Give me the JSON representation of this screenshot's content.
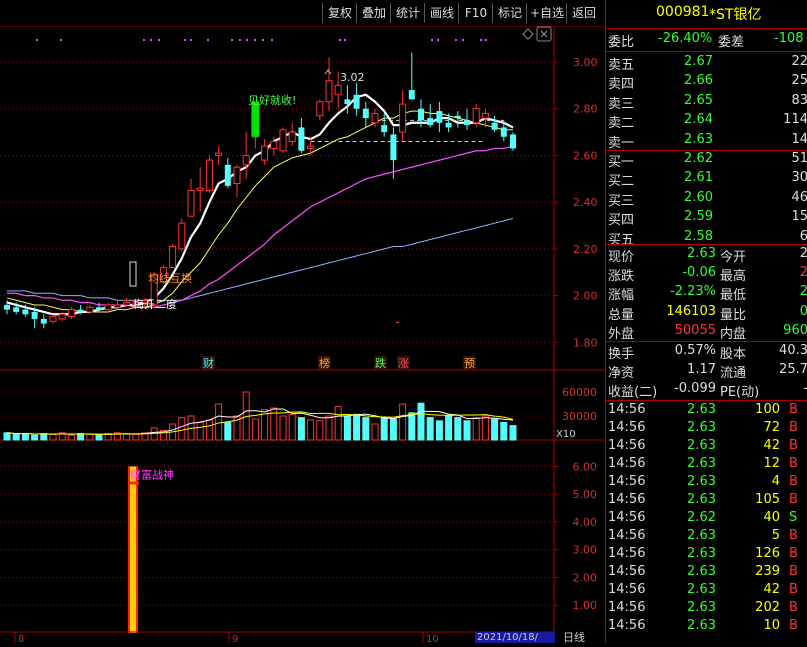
{
  "toolbar": {
    "buttons": [
      "复权",
      "叠加",
      "统计",
      "画线",
      "F10",
      "标记",
      "+自选",
      "返回"
    ]
  },
  "main_chart": {
    "y_ticks": [
      "3.00",
      "2.80",
      "2.60",
      "2.40",
      "2.20",
      "2.00",
      "1.80"
    ],
    "annotations": {
      "peak": "3.02",
      "sell_signal": "见好就收!",
      "cross_label": "均线互换",
      "pattern_label": "梅开二度"
    },
    "event_markers": [
      "财",
      "榜",
      "跌",
      "涨",
      "预"
    ],
    "colors": {
      "up": "#ff3232",
      "down": "#54fcfc",
      "ma5": "#ffffff",
      "ma10": "#ffff50",
      "ma20": "#ff50ff",
      "ma60": "#90b0ff"
    }
  },
  "chart_data": [
    {
      "type": "candlestick",
      "ylim": [
        1.72,
        3.12
      ],
      "y_ticks": [
        3.0,
        2.8,
        2.6,
        2.4,
        2.2,
        2.0,
        1.8
      ],
      "candles": [
        {
          "o": 1.96,
          "h": 1.98,
          "l": 1.92,
          "c": 1.94
        },
        {
          "o": 1.95,
          "h": 1.97,
          "l": 1.92,
          "c": 1.93
        },
        {
          "o": 1.94,
          "h": 1.96,
          "l": 1.91,
          "c": 1.92
        },
        {
          "o": 1.93,
          "h": 1.95,
          "l": 1.86,
          "c": 1.9
        },
        {
          "o": 1.9,
          "h": 1.92,
          "l": 1.86,
          "c": 1.88
        },
        {
          "o": 1.89,
          "h": 1.92,
          "l": 1.88,
          "c": 1.91
        },
        {
          "o": 1.9,
          "h": 1.93,
          "l": 1.89,
          "c": 1.92
        },
        {
          "o": 1.91,
          "h": 1.95,
          "l": 1.9,
          "c": 1.94
        },
        {
          "o": 1.94,
          "h": 1.96,
          "l": 1.92,
          "c": 1.93
        },
        {
          "o": 1.93,
          "h": 1.96,
          "l": 1.92,
          "c": 1.95
        },
        {
          "o": 1.95,
          "h": 1.97,
          "l": 1.93,
          "c": 1.94
        },
        {
          "o": 1.94,
          "h": 1.97,
          "l": 1.93,
          "c": 1.96
        },
        {
          "o": 1.95,
          "h": 1.98,
          "l": 1.94,
          "c": 1.96
        },
        {
          "o": 1.96,
          "h": 1.99,
          "l": 1.95,
          "c": 1.97
        },
        {
          "o": 1.96,
          "h": 1.98,
          "l": 1.95,
          "c": 1.97
        },
        {
          "o": 1.97,
          "h": 1.99,
          "l": 1.95,
          "c": 1.98
        },
        {
          "o": 1.96,
          "h": 2.1,
          "l": 1.95,
          "c": 2.09
        },
        {
          "o": 2.06,
          "h": 2.13,
          "l": 2.05,
          "c": 2.12
        },
        {
          "o": 2.12,
          "h": 2.22,
          "l": 2.12,
          "c": 2.21
        },
        {
          "o": 2.2,
          "h": 2.33,
          "l": 2.19,
          "c": 2.31
        },
        {
          "o": 2.34,
          "h": 2.5,
          "l": 2.34,
          "c": 2.45
        },
        {
          "o": 2.45,
          "h": 2.55,
          "l": 2.36,
          "c": 2.46
        },
        {
          "o": 2.45,
          "h": 2.6,
          "l": 2.44,
          "c": 2.58
        },
        {
          "o": 2.6,
          "h": 2.64,
          "l": 2.56,
          "c": 2.61
        },
        {
          "o": 2.56,
          "h": 2.59,
          "l": 2.46,
          "c": 2.47
        },
        {
          "o": 2.48,
          "h": 2.56,
          "l": 2.42,
          "c": 2.55
        },
        {
          "o": 2.56,
          "h": 2.7,
          "l": 2.5,
          "c": 2.6
        },
        {
          "o": 2.68,
          "h": 2.83,
          "l": 2.63,
          "c": 2.82
        },
        {
          "o": 2.58,
          "h": 2.67,
          "l": 2.56,
          "c": 2.64
        },
        {
          "o": 2.63,
          "h": 2.68,
          "l": 2.6,
          "c": 2.66
        },
        {
          "o": 2.62,
          "h": 2.72,
          "l": 2.61,
          "c": 2.71
        },
        {
          "o": 2.66,
          "h": 2.74,
          "l": 2.64,
          "c": 2.7
        },
        {
          "o": 2.72,
          "h": 2.76,
          "l": 2.61,
          "c": 2.62
        },
        {
          "o": 2.63,
          "h": 2.68,
          "l": 2.6,
          "c": 2.64
        },
        {
          "o": 2.77,
          "h": 2.84,
          "l": 2.75,
          "c": 2.83
        },
        {
          "o": 2.83,
          "h": 3.02,
          "l": 2.79,
          "c": 2.92
        },
        {
          "o": 2.86,
          "h": 2.96,
          "l": 2.8,
          "c": 2.9
        },
        {
          "o": 2.84,
          "h": 2.9,
          "l": 2.78,
          "c": 2.82
        },
        {
          "o": 2.86,
          "h": 2.91,
          "l": 2.77,
          "c": 2.8
        },
        {
          "o": 2.8,
          "h": 2.83,
          "l": 2.72,
          "c": 2.76
        },
        {
          "o": 2.74,
          "h": 2.8,
          "l": 2.72,
          "c": 2.78
        },
        {
          "o": 2.73,
          "h": 2.78,
          "l": 2.68,
          "c": 2.7
        },
        {
          "o": 2.69,
          "h": 2.72,
          "l": 2.5,
          "c": 2.58
        },
        {
          "o": 2.7,
          "h": 2.88,
          "l": 2.66,
          "c": 2.82
        },
        {
          "o": 2.88,
          "h": 3.04,
          "l": 2.84,
          "c": 2.84
        },
        {
          "o": 2.8,
          "h": 2.84,
          "l": 2.72,
          "c": 2.75
        },
        {
          "o": 2.76,
          "h": 2.82,
          "l": 2.72,
          "c": 2.73
        },
        {
          "o": 2.79,
          "h": 2.83,
          "l": 2.7,
          "c": 2.74
        },
        {
          "o": 2.74,
          "h": 2.78,
          "l": 2.7,
          "c": 2.72
        },
        {
          "o": 2.77,
          "h": 2.79,
          "l": 2.72,
          "c": 2.76
        },
        {
          "o": 2.75,
          "h": 2.8,
          "l": 2.71,
          "c": 2.73
        },
        {
          "o": 2.74,
          "h": 2.82,
          "l": 2.72,
          "c": 2.8
        },
        {
          "o": 2.76,
          "h": 2.8,
          "l": 2.72,
          "c": 2.78
        },
        {
          "o": 2.74,
          "h": 2.77,
          "l": 2.7,
          "c": 2.71
        },
        {
          "o": 2.72,
          "h": 2.75,
          "l": 2.66,
          "c": 2.68
        },
        {
          "o": 2.69,
          "h": 2.7,
          "l": 2.62,
          "c": 2.63
        }
      ],
      "ma5": [
        1.97,
        1.96,
        1.95,
        1.94,
        1.93,
        1.92,
        1.92,
        1.92,
        1.93,
        1.93,
        1.94,
        1.95,
        1.95,
        1.96,
        1.96,
        1.97,
        1.99,
        2.03,
        2.09,
        2.16,
        2.25,
        2.31,
        2.4,
        2.48,
        2.5,
        2.53,
        2.55,
        2.6,
        2.62,
        2.66,
        2.68,
        2.7,
        2.68,
        2.67,
        2.69,
        2.74,
        2.78,
        2.81,
        2.85,
        2.86,
        2.83,
        2.79,
        2.73,
        2.73,
        2.74,
        2.74,
        2.74,
        2.76,
        2.76,
        2.74,
        2.74,
        2.74,
        2.76,
        2.75,
        2.74,
        2.72
      ],
      "ma10": [
        1.99,
        1.98,
        1.97,
        1.96,
        1.96,
        1.95,
        1.94,
        1.94,
        1.93,
        1.93,
        1.93,
        1.93,
        1.94,
        1.94,
        1.95,
        1.95,
        1.96,
        1.98,
        2.01,
        2.06,
        2.1,
        2.14,
        2.2,
        2.26,
        2.31,
        2.37,
        2.42,
        2.47,
        2.51,
        2.55,
        2.57,
        2.59,
        2.6,
        2.61,
        2.63,
        2.65,
        2.67,
        2.68,
        2.7,
        2.72,
        2.74,
        2.76,
        2.76,
        2.78,
        2.79,
        2.79,
        2.78,
        2.78,
        2.77,
        2.76,
        2.75,
        2.74,
        2.73,
        2.72,
        2.71,
        2.71
      ],
      "ma20": [
        2.01,
        2.01,
        2.0,
        2.0,
        1.99,
        1.99,
        1.98,
        1.98,
        1.97,
        1.97,
        1.96,
        1.96,
        1.96,
        1.96,
        1.95,
        1.95,
        1.95,
        1.96,
        1.97,
        1.98,
        2.0,
        2.02,
        2.05,
        2.07,
        2.1,
        2.13,
        2.16,
        2.19,
        2.22,
        2.26,
        2.29,
        2.32,
        2.35,
        2.38,
        2.4,
        2.42,
        2.44,
        2.46,
        2.48,
        2.5,
        2.51,
        2.52,
        2.53,
        2.54,
        2.55,
        2.56,
        2.57,
        2.58,
        2.59,
        2.6,
        2.61,
        2.62,
        2.62,
        2.63,
        2.63,
        2.64
      ],
      "ma60": [
        2.02,
        2.02,
        2.02,
        2.01,
        2.01,
        2.01,
        2.0,
        2.0,
        2.0,
        1.99,
        1.99,
        1.99,
        1.98,
        1.98,
        1.98,
        1.98,
        1.98,
        1.98,
        1.98,
        1.98,
        1.99,
        2.0,
        2.01,
        2.02,
        2.03,
        2.04,
        2.05,
        2.06,
        2.07,
        2.08,
        2.09,
        2.1,
        2.11,
        2.12,
        2.13,
        2.14,
        2.15,
        2.16,
        2.17,
        2.18,
        2.19,
        2.2,
        2.21,
        2.21,
        2.22,
        2.23,
        2.24,
        2.25,
        2.26,
        2.27,
        2.28,
        2.29,
        2.3,
        2.31,
        2.32,
        2.33
      ]
    },
    {
      "type": "bar",
      "ylabel": "X10",
      "y_ticks": [
        60000,
        30000
      ],
      "ylim": [
        0,
        80000
      ],
      "values": [
        9000,
        7000,
        8000,
        6000,
        8000,
        7000,
        9000,
        6000,
        8000,
        7000,
        6000,
        8000,
        9000,
        8000,
        7000,
        9000,
        15000,
        12000,
        20000,
        28000,
        30000,
        22000,
        25000,
        45000,
        22000,
        30000,
        60000,
        26000,
        38000,
        40000,
        30000,
        32000,
        28000,
        25000,
        24000,
        30000,
        42000,
        30000,
        32000,
        28000,
        20000,
        28000,
        26000,
        45000,
        34000,
        46000,
        28000,
        24000,
        30000,
        28000,
        24000,
        28000,
        30000,
        26000,
        22000,
        18000
      ]
    },
    {
      "type": "bar",
      "title": "财富战神",
      "y_ticks": [
        6.0,
        5.0,
        4.0,
        3.0,
        2.0,
        1.0
      ],
      "ylim": [
        0,
        6.7
      ],
      "signal_bar": {
        "index": 19,
        "value": 6.0
      }
    }
  ],
  "quote": {
    "code": "000981",
    "name": "*ST银亿",
    "weibi_label": "委比",
    "weibi": "-26.40%",
    "weicha_label": "委差",
    "weicha": "-108",
    "sell": [
      {
        "label": "卖五",
        "price": "2.67",
        "vol": "22"
      },
      {
        "label": "卖四",
        "price": "2.66",
        "vol": "25"
      },
      {
        "label": "卖三",
        "price": "2.65",
        "vol": "83"
      },
      {
        "label": "卖二",
        "price": "2.64",
        "vol": "114"
      },
      {
        "label": "卖一",
        "price": "2.63",
        "vol": "14"
      }
    ],
    "buy": [
      {
        "label": "买一",
        "price": "2.62",
        "vol": "51"
      },
      {
        "label": "买二",
        "price": "2.61",
        "vol": "30"
      },
      {
        "label": "买三",
        "price": "2.60",
        "vol": "46"
      },
      {
        "label": "买四",
        "price": "2.59",
        "vol": "15"
      },
      {
        "label": "买五",
        "price": "2.58",
        "vol": "6"
      }
    ],
    "stats": [
      {
        "l1": "现价",
        "v1": "2.63",
        "c1": "g",
        "l2": "今开",
        "v2": "2",
        "c2": "w"
      },
      {
        "l1": "涨跌",
        "v1": "-0.06",
        "c1": "g",
        "l2": "最高",
        "v2": "2",
        "c2": "r"
      },
      {
        "l1": "涨幅",
        "v1": "-2.23%",
        "c1": "g",
        "l2": "最低",
        "v2": "2",
        "c2": "g"
      },
      {
        "l1": "总量",
        "v1": "146103",
        "c1": "y",
        "l2": "量比",
        "v2": "0",
        "c2": "g"
      },
      {
        "l1": "外盘",
        "v1": "50055",
        "c1": "r",
        "l2": "内盘",
        "v2": "960",
        "c2": "g"
      }
    ],
    "fundamentals": [
      {
        "l1": "换手",
        "v1": "0.57%",
        "l2": "股本",
        "v2": "40.3"
      },
      {
        "l1": "净资",
        "v1": "1.17",
        "l2": "流通",
        "v2": "25.7"
      },
      {
        "l1": "收益(二)",
        "v1": "-0.099",
        "l2": "PE(动)",
        "v2": "-"
      }
    ]
  },
  "ticks": [
    {
      "time": "14:56",
      "price": "2.63",
      "vol": "100",
      "bs": "B"
    },
    {
      "time": "14:56",
      "price": "2.63",
      "vol": "72",
      "bs": "B"
    },
    {
      "time": "14:56",
      "price": "2.63",
      "vol": "42",
      "bs": "B"
    },
    {
      "time": "14:56",
      "price": "2.63",
      "vol": "12",
      "bs": "B"
    },
    {
      "time": "14:56",
      "price": "2.63",
      "vol": "4",
      "bs": "B"
    },
    {
      "time": "14:56",
      "price": "2.63",
      "vol": "105",
      "bs": "B"
    },
    {
      "time": "14:56",
      "price": "2.62",
      "vol": "40",
      "bs": "S"
    },
    {
      "time": "14:56",
      "price": "2.63",
      "vol": "5",
      "bs": "B"
    },
    {
      "time": "14:56",
      "price": "2.63",
      "vol": "126",
      "bs": "B"
    },
    {
      "time": "14:56",
      "price": "2.63",
      "vol": "239",
      "bs": "B"
    },
    {
      "time": "14:56",
      "price": "2.63",
      "vol": "42",
      "bs": "B"
    },
    {
      "time": "14:56",
      "price": "2.63",
      "vol": "202",
      "bs": "B"
    },
    {
      "time": "14:56",
      "price": "2.63",
      "vol": "10",
      "bs": "B"
    }
  ],
  "bottom_bar": {
    "date": "2021/10/18/",
    "period": "日线",
    "axis_marks": [
      "8",
      "9",
      "10"
    ]
  }
}
